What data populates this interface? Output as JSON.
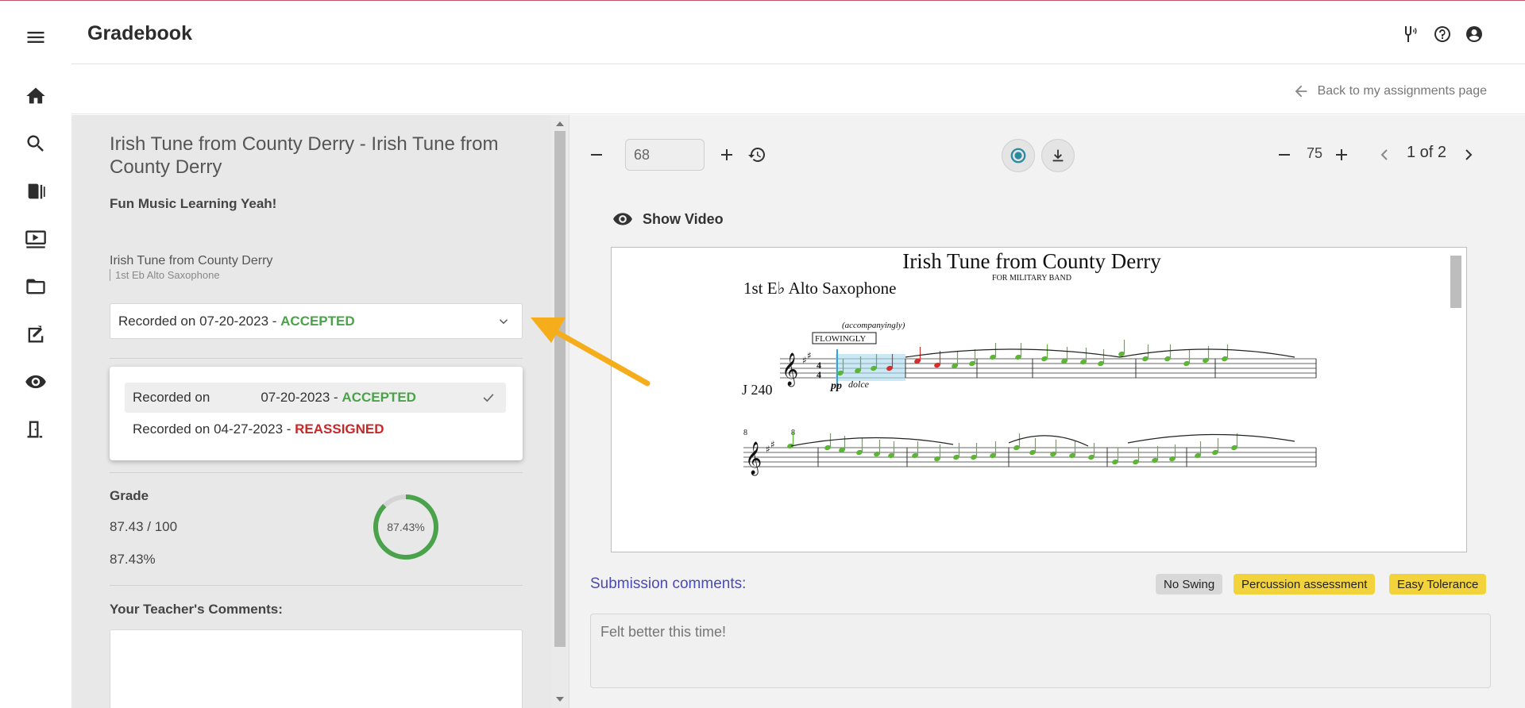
{
  "header": {
    "title": "Gradebook"
  },
  "subheader": {
    "back_label": "Back to my assignments page"
  },
  "assignment": {
    "title": "Irish Tune from County Derry - Irish Tune from County Derry",
    "subtitle": "Fun Music Learning Yeah!",
    "piece_name": "Irish Tune from County Derry",
    "piece_part": "1st Eb Alto Saxophone"
  },
  "recording_select": {
    "prefix": "Recorded on 07-20-2023 - ",
    "status": "ACCEPTED"
  },
  "recording_options": [
    {
      "prefix": "Recorded on",
      "date": "07-20-2023 - ",
      "status": "ACCEPTED",
      "selected": true
    },
    {
      "prefix": "Recorded on 04-27-2023 - ",
      "status": "REASSIGNED",
      "selected": false
    }
  ],
  "grade": {
    "label": "Grade",
    "score": "87.43 / 100",
    "percent": "87.43%",
    "ring_text": "87.43%",
    "ring_fraction": 0.8743
  },
  "comments": {
    "label": "Your Teacher's Comments:"
  },
  "toolbar": {
    "tempo_value": "68",
    "zoom_value": "75",
    "page_indicator": "1 of 2"
  },
  "show_video_label": "Show Video",
  "score": {
    "title": "Irish Tune from County Derry",
    "subtitle": "FOR MILITARY BAND",
    "part": "1st E♭ Alto Saxophone",
    "accompany": "(accompanyingly)",
    "tempo_box": "FLOWINGLY",
    "tempo_mark": "J 240",
    "dynamic": "pp",
    "expression": "dolce",
    "time_sig": "4",
    "measure_num": "8"
  },
  "submission": {
    "label": "Submission comments:",
    "tags": [
      "No Swing",
      "Percussion assessment",
      "Easy Tolerance"
    ],
    "comment_placeholder": "Felt better this time!"
  },
  "colors": {
    "accepted": "#4aa34a",
    "reassigned": "#c62828",
    "note_correct": "#5cb535",
    "note_wrong": "#d32f2f",
    "tag_yellow": "#f2d33c",
    "arrow": "#f5ad1b"
  }
}
